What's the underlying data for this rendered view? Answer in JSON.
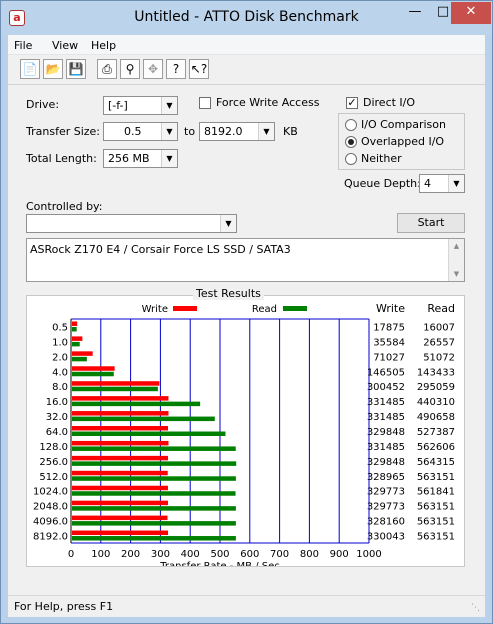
{
  "window": {
    "title": "Untitled - ATTO Disk Benchmark"
  },
  "menu": [
    "File",
    "View",
    "Help"
  ],
  "toolbar_icons": [
    "new-icon",
    "open-icon",
    "save-icon",
    "print-icon",
    "print-preview-icon",
    "move-icon",
    "help-icon",
    "context-help-icon"
  ],
  "settings": {
    "drive_label": "Drive:",
    "drive_value": "[-f-]",
    "force_write_label": "Force Write Access",
    "direct_io_label": "Direct I/O",
    "transfer_size_label": "Transfer Size:",
    "transfer_from": "0.5",
    "to_label": "to",
    "transfer_to": "8192.0",
    "kb_label": "KB",
    "total_length_label": "Total Length:",
    "total_length_value": "256 MB",
    "io_comparison_label": "I/O Comparison",
    "overlapped_io_label": "Overlapped I/O",
    "neither_label": "Neither",
    "queue_depth_label": "Queue Depth:",
    "queue_depth_value": "4",
    "controlled_by_label": "Controlled by:",
    "controlled_by_value": "",
    "start_label": "Start",
    "description": "ASRock Z170 E4 / Corsair Force LS SSD / SATA3"
  },
  "colors": {
    "write": "#ff0000",
    "read": "#008000",
    "grid": "#0000cc"
  },
  "status": {
    "text": "For Help, press F1"
  },
  "chart_data": {
    "type": "bar",
    "title": "Test Results",
    "xlabel": "Transfer Rate - MB / Sec",
    "xlim": [
      0,
      1000
    ],
    "xticks": [
      "0",
      "100",
      "200",
      "300",
      "400",
      "500",
      "600",
      "700",
      "800",
      "900",
      "1000"
    ],
    "categories": [
      "0.5",
      "1.0",
      "2.0",
      "4.0",
      "8.0",
      "16.0",
      "32.0",
      "64.0",
      "128.0",
      "256.0",
      "512.0",
      "1024.0",
      "2048.0",
      "4096.0",
      "8192.0"
    ],
    "legend": [
      "Write",
      "Read"
    ],
    "column_headers": [
      "Write",
      "Read"
    ],
    "series": [
      {
        "name": "Write",
        "values": [
          17875,
          35584,
          71027,
          146505,
          300452,
          331485,
          331485,
          329848,
          331485,
          329848,
          328965,
          329773,
          329773,
          328160,
          330043
        ]
      },
      {
        "name": "Read",
        "values": [
          16007,
          26557,
          51072,
          143433,
          295059,
          440310,
          490658,
          527387,
          562606,
          564315,
          563151,
          561841,
          563151,
          563151,
          563151
        ]
      }
    ]
  }
}
